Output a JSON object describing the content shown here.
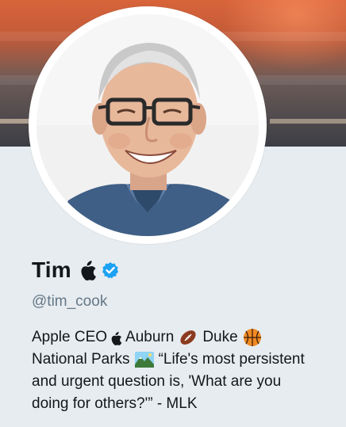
{
  "profile": {
    "display_name": "Tim",
    "handle": "@tim_cook",
    "verified": true,
    "name_icon": "apple-logo-icon",
    "verified_icon": "verified-badge-icon",
    "verified_color": "#1da1f2"
  },
  "bio": {
    "line1": {
      "part1": "Apple CEO",
      "part2": "Auburn",
      "part3": "Duke"
    },
    "line2": {
      "part1": "National Parks",
      "part2": "“Life's most persistent"
    },
    "line3": "and urgent question is, 'What are you",
    "line4": "doing for others?'” - MLK",
    "icons": [
      "apple-logo-icon",
      "football-icon",
      "basketball-icon",
      "national-park-icon"
    ]
  },
  "colors": {
    "background": "#e6ecf0",
    "text_primary": "#14171a",
    "text_secondary": "#657786",
    "banner_top": "#d8643a",
    "banner_bottom": "#3c3e45"
  }
}
